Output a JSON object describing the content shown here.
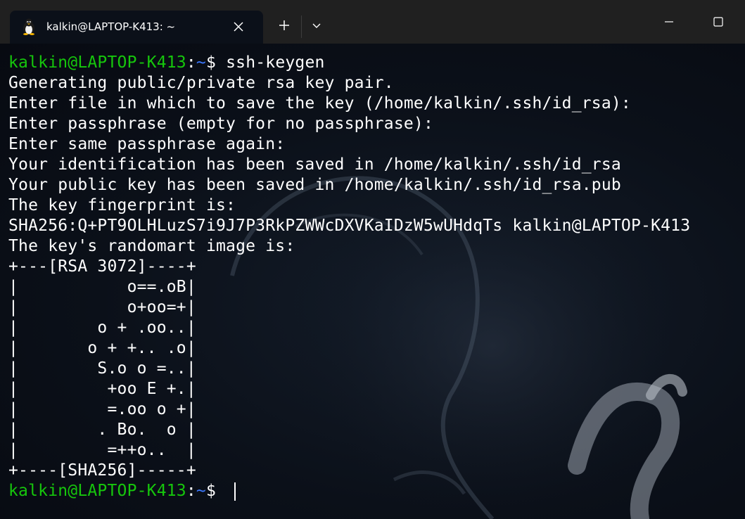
{
  "window": {
    "tab": {
      "title": "kalkin@LAPTOP-K413: ~",
      "icon": "linux-penguin-icon"
    },
    "controls": {
      "new_tab": "plus-icon",
      "dropdown": "chevron-down-icon",
      "minimize": "minimize-icon",
      "maximize": "maximize-icon"
    }
  },
  "terminal": {
    "colors": {
      "user": "#16c60c",
      "path": "#3b78ff",
      "text": "#ffffff",
      "background": "#0b1019"
    },
    "prompt": {
      "user_host": "kalkin@LAPTOP-K413",
      "colon": ":",
      "path": "~",
      "symbol": "$ "
    },
    "command": "ssh-keygen",
    "output": [
      "Generating public/private rsa key pair.",
      "Enter file in which to save the key (/home/kalkin/.ssh/id_rsa):",
      "Enter passphrase (empty for no passphrase):",
      "Enter same passphrase again:",
      "Your identification has been saved in /home/kalkin/.ssh/id_rsa",
      "Your public key has been saved in /home/kalkin/.ssh/id_rsa.pub",
      "The key fingerprint is:",
      "SHA256:Q+PT9OLHLuzS7i9J7P3RkPZWWcDXVKaIDzW5wUHdqTs kalkin@LAPTOP-K413",
      "The key's randomart image is:",
      "+---[RSA 3072]----+",
      "|           o==.oB|",
      "|           o+oo=+|",
      "|        o + .oo..|",
      "|       o + +.. .o|",
      "|        S.o o =..|",
      "|         +oo E +.|",
      "|         =.oo o +|",
      "|        . Bo.  o |",
      "|         =++o..  |",
      "+----[SHA256]-----+"
    ]
  }
}
